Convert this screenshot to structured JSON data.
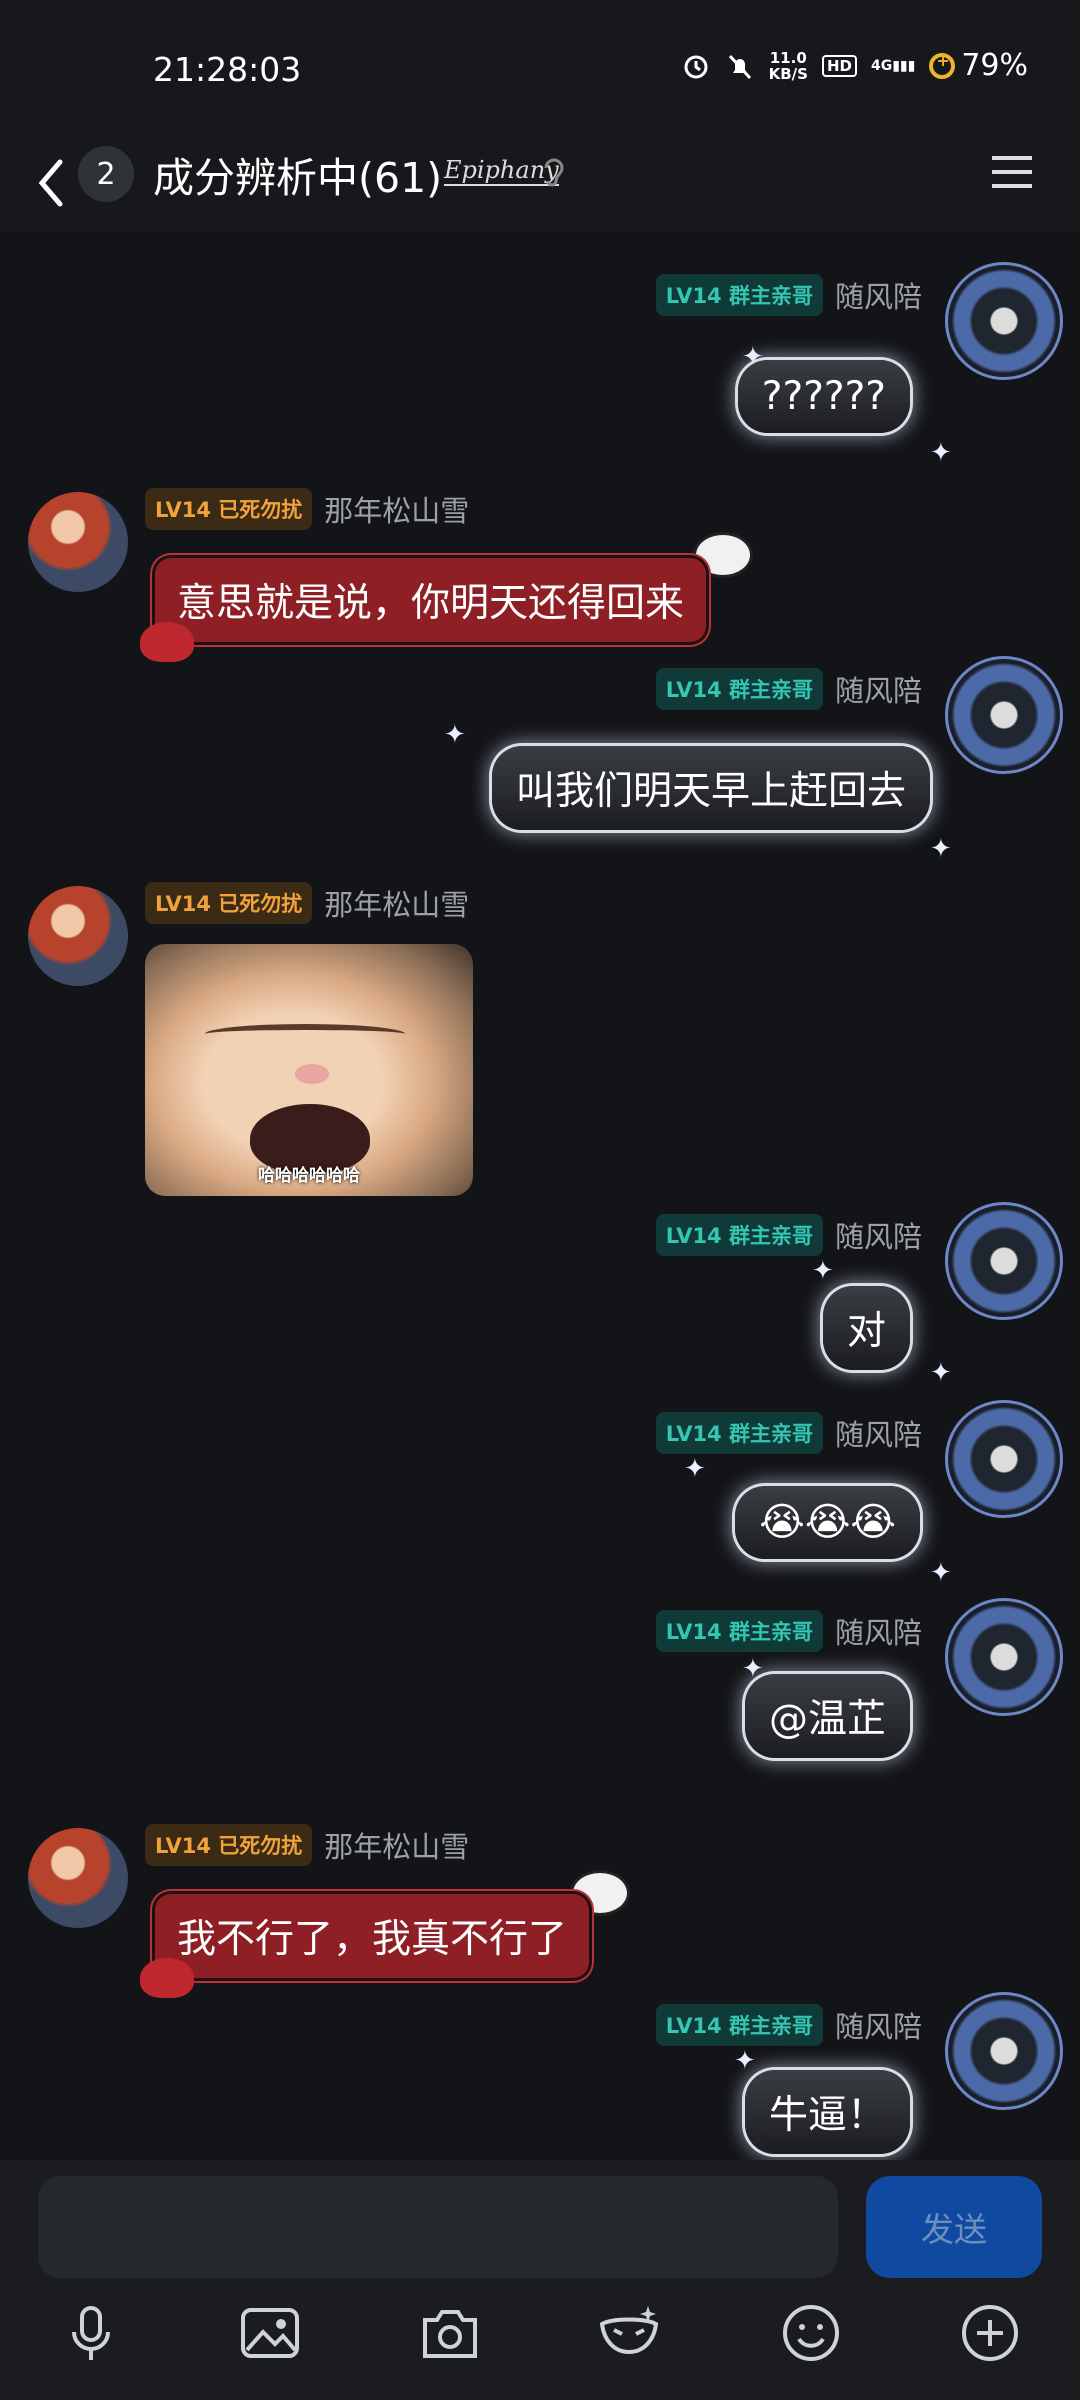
{
  "status_bar": {
    "time": "21:28:03",
    "net_speed_value": "11.0",
    "net_speed_unit": "KB/S",
    "hd": "HD",
    "signal": "4G",
    "battery": "79%"
  },
  "header": {
    "unread_count": "2",
    "title": "成分辨析中(61)",
    "badge_text": "Epiphany"
  },
  "messages": [
    {
      "side": "right",
      "level": "LV14 群主亲哥",
      "nick": "随风陪",
      "text": "??????"
    },
    {
      "side": "left",
      "level": "LV14 已死勿扰",
      "nick": "那年松山雪",
      "text": "意思就是说，你明天还得回来"
    },
    {
      "side": "right",
      "level": "LV14 群主亲哥",
      "nick": "随风陪",
      "text": "叫我们明天早上赶回去"
    },
    {
      "side": "left",
      "level": "LV14 已死勿扰",
      "nick": "那年松山雪",
      "sticker_caption": "哈哈哈哈哈哈"
    },
    {
      "side": "right",
      "level": "LV14 群主亲哥",
      "nick": "随风陪",
      "text": "对"
    },
    {
      "side": "right",
      "level": "LV14 群主亲哥",
      "nick": "随风陪",
      "text": "😭😭😭"
    },
    {
      "side": "right",
      "level": "LV14 群主亲哥",
      "nick": "随风陪",
      "text": "@温芷"
    },
    {
      "side": "left",
      "level": "LV14 已死勿扰",
      "nick": "那年松山雪",
      "text": "我不行了，我真不行了"
    },
    {
      "side": "right",
      "level": "LV14 群主亲哥",
      "nick": "随风陪",
      "text": "牛逼！"
    }
  ],
  "input": {
    "value": "",
    "send_label": "发送"
  },
  "colors": {
    "background": "#121417",
    "send_button": "#0f4aa0",
    "red_bubble": "#8e1f25",
    "level_left": "#f2a23a",
    "level_right": "#34c6b2"
  },
  "toolbar_icons": [
    "mic-icon",
    "image-icon",
    "camera-icon",
    "mask-icon",
    "emoji-icon",
    "plus-circle-icon"
  ]
}
